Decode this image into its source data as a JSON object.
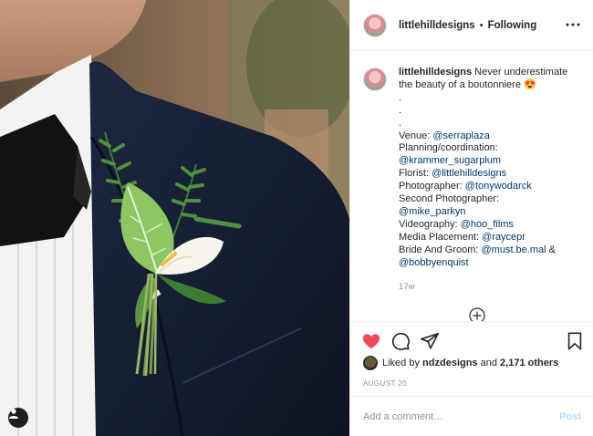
{
  "post": {
    "author": "littlehilldesigns",
    "follow_status": "Following",
    "separator": "•",
    "caption": {
      "username": "littlehilldesigns",
      "first_line": "Never underestimate",
      "second_line": "the beauty of a boutonniere",
      "emoji": "😍",
      "dots": [
        ".",
        ".",
        "."
      ],
      "credits": [
        {
          "label": "Venue: ",
          "handle": "@serraplaza"
        },
        {
          "label": "Planning/coordination:",
          "handle": ""
        },
        {
          "label": "",
          "handle": "@krammer_sugarplum"
        },
        {
          "label": "Florist: ",
          "handle": "@littlehilldesigns"
        },
        {
          "label": "Photographer: ",
          "handle": "@tonywodarck"
        },
        {
          "label": "Second Photographer:",
          "handle": ""
        },
        {
          "label": "",
          "handle": "@mike_parkyn"
        },
        {
          "label": "Videography: ",
          "handle": "@hoo_films"
        },
        {
          "label": "Media Placement: ",
          "handle": "@raycepr"
        },
        {
          "label": "Bride And Groom: ",
          "handle": "@must.be.mal",
          "suffix": " &"
        },
        {
          "label": "",
          "handle": "@bobbyenquist"
        }
      ],
      "time_ago": "17w"
    },
    "likes": {
      "prefix": "Liked by",
      "user": "ndzdesigns",
      "middle": "and",
      "others": "2,171 others"
    },
    "date": "AUGUST 20",
    "comment": {
      "placeholder": "Add a comment…",
      "post_label": "Post"
    },
    "icons": {
      "more": "more-horizontal-icon",
      "like": "heart-filled-icon",
      "comment": "comment-bubble-icon",
      "share": "paper-plane-icon",
      "save": "bookmark-icon",
      "load_more": "plus-circle-icon",
      "user_tag": "user-tag-icon"
    },
    "colors": {
      "like_red": "#ed4956",
      "link_blue": "#00376b",
      "post_button_disabled": "#b2dffc",
      "muted_text": "#8e8e8e"
    }
  }
}
